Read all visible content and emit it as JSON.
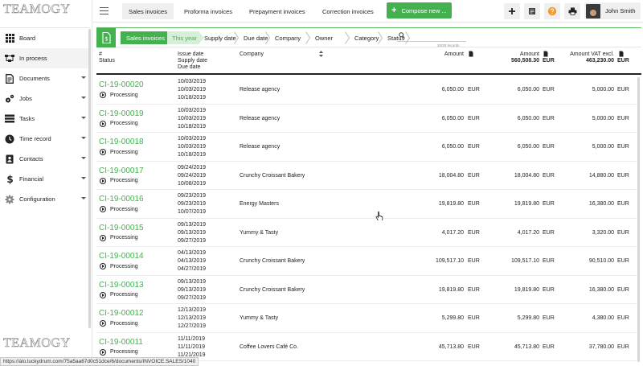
{
  "brand": {
    "name": "TEAMOGY"
  },
  "sidebar": {
    "items": [
      {
        "label": "Board",
        "icon": "grid-icon",
        "caret": false,
        "active": false
      },
      {
        "label": "In process",
        "icon": "flow-icon",
        "caret": false,
        "active": true
      },
      {
        "label": "Documents",
        "icon": "document-icon",
        "caret": true,
        "active": false
      },
      {
        "label": "Jobs",
        "icon": "gears-icon",
        "caret": true,
        "active": false
      },
      {
        "label": "Tasks",
        "icon": "tasks-icon",
        "caret": true,
        "active": false
      },
      {
        "label": "Time record",
        "icon": "clock-icon",
        "caret": true,
        "active": false
      },
      {
        "label": "Contacts",
        "icon": "contacts-icon",
        "caret": true,
        "active": false
      },
      {
        "label": "Financial",
        "icon": "dollar-icon",
        "caret": true,
        "active": false
      },
      {
        "label": "Configuration",
        "icon": "gear-icon",
        "caret": true,
        "active": false
      }
    ]
  },
  "topbar": {
    "tabs": [
      "Sales invoices",
      "Proforma invoices",
      "Prepayment invoices",
      "Correction invoices"
    ],
    "compose_label": "Compose new ...",
    "user_name": "John Smith"
  },
  "filters": {
    "active": "Sales invoices",
    "period": "This year",
    "columns": [
      "Supply date",
      "Due date",
      "Company",
      "Owner",
      "Category",
      "Status"
    ],
    "search_placeholder": "",
    "records": "20/20 records"
  },
  "table": {
    "headers": {
      "num": "#",
      "status": "Status",
      "issue": "Issue date",
      "supply": "Supply date",
      "due": "Due date",
      "company": "Company",
      "amount1": "Amount",
      "amount2": "Amount",
      "amount2_total": "560,508.30",
      "amount2_cur": "EUR",
      "amount3": "Amount VAT excl.",
      "amount3_total": "463,230.00",
      "amount3_cur": "EUR"
    },
    "rows": [
      {
        "num": "CI-19-00020",
        "status": "Processing",
        "d1": "10/03/2019",
        "d2": "10/03/2019",
        "d3": "10/18/2019",
        "company": "Release agency",
        "a1": "6,050.00",
        "a2": "6,050.00",
        "a3": "5,000.00",
        "cur": "EUR"
      },
      {
        "num": "CI-19-00019",
        "status": "Processing",
        "d1": "10/03/2019",
        "d2": "10/03/2019",
        "d3": "10/18/2019",
        "company": "Release agency",
        "a1": "6,050.00",
        "a2": "6,050.00",
        "a3": "5,000.00",
        "cur": "EUR"
      },
      {
        "num": "CI-19-00018",
        "status": "Processing",
        "d1": "10/03/2019",
        "d2": "10/03/2019",
        "d3": "10/18/2019",
        "company": "Release agency",
        "a1": "6,050.00",
        "a2": "6,050.00",
        "a3": "5,000.00",
        "cur": "EUR"
      },
      {
        "num": "CI-19-00017",
        "status": "Processing",
        "d1": "09/24/2019",
        "d2": "09/24/2019",
        "d3": "10/08/2019",
        "company": "Crunchy Croissant Bakery",
        "a1": "18,004.80",
        "a2": "18,004.80",
        "a3": "14,880.00",
        "cur": "EUR"
      },
      {
        "num": "CI-19-00016",
        "status": "Processing",
        "d1": "09/23/2019",
        "d2": "09/23/2019",
        "d3": "10/07/2019",
        "company": "Energy Masters",
        "a1": "19,819.80",
        "a2": "19,819.80",
        "a3": "16,380.00",
        "cur": "EUR"
      },
      {
        "num": "CI-19-00015",
        "status": "Processing",
        "d1": "09/13/2019",
        "d2": "09/13/2019",
        "d3": "09/27/2019",
        "company": "Yummy & Tasty",
        "a1": "4,017.20",
        "a2": "4,017.20",
        "a3": "3,320.00",
        "cur": "EUR"
      },
      {
        "num": "CI-19-00014",
        "status": "Processing",
        "d1": "04/13/2019",
        "d2": "04/13/2019",
        "d3": "04/27/2019",
        "company": "Crunchy Croissant Bakery",
        "a1": "109,517.10",
        "a2": "109,517.10",
        "a3": "90,510.00",
        "cur": "EUR"
      },
      {
        "num": "CI-19-00013",
        "status": "Processing",
        "d1": "09/13/2019",
        "d2": "09/13/2019",
        "d3": "09/27/2019",
        "company": "Crunchy Croissant Bakery",
        "a1": "19,819.80",
        "a2": "19,819.80",
        "a3": "16,380.00",
        "cur": "EUR"
      },
      {
        "num": "CI-19-00012",
        "status": "Processing",
        "d1": "12/13/2019",
        "d2": "12/13/2019",
        "d3": "12/27/2019",
        "company": "Yummy & Tasty",
        "a1": "5,299.80",
        "a2": "5,299.80",
        "a3": "4,380.00",
        "cur": "EUR"
      },
      {
        "num": "CI-19-00011",
        "status": "Processing",
        "d1": "11/11/2019",
        "d2": "11/11/2019",
        "d3": "11/21/2019",
        "company": "Coffee Lovers Café Co.",
        "a1": "45,713.80",
        "a2": "45,713.80",
        "a3": "37,780.00",
        "cur": "EUR"
      }
    ]
  },
  "statusbar": {
    "url": "https://alo.luckydrum.com/75a5aa67d0c51dce/6/documents/INVOICE.SALES/1040"
  },
  "colors": {
    "accent": "#44b14f",
    "accent_light": "#d7efd8",
    "help": "#f39a2d"
  }
}
